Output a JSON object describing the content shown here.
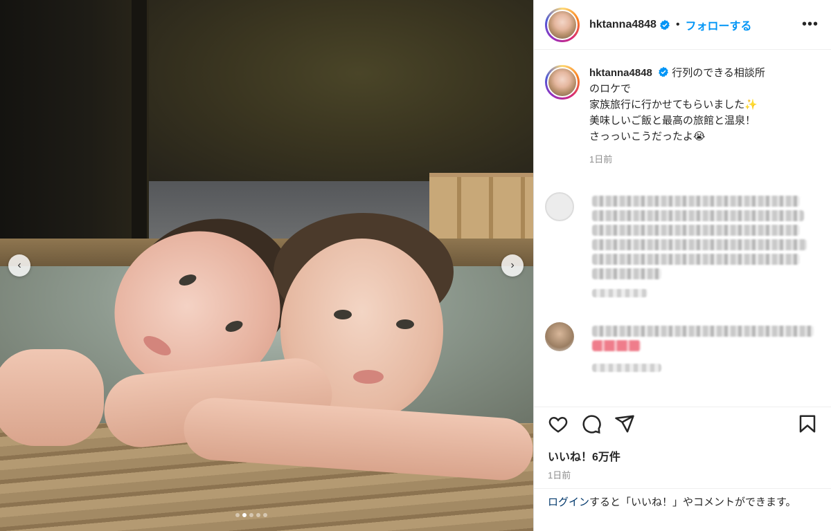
{
  "post": {
    "username": "hktanna4848",
    "follow_label": "フォローする",
    "more_label": "•••",
    "separator": "•"
  },
  "caption": {
    "username": "hktanna4848",
    "lines": [
      "行列のできる相談所",
      "のロケで",
      "家族旅行に行かせてもらいました✨",
      "美味しいご飯と最高の旅館と温泉！",
      "さっっいこうだったよ😭"
    ],
    "time": "1日前"
  },
  "actions": {
    "likes": "いいね！6万件",
    "time": "1日前"
  },
  "login_prompt": {
    "link": "ログイン",
    "rest": "すると「いいね！」やコメントができます。"
  },
  "media": {
    "prev": "‹",
    "next": "›",
    "slide_count": 5,
    "active_slide": 1
  },
  "colors": {
    "link": "#0095f6",
    "verified": "#0095f6",
    "text": "#262626",
    "muted": "#8e8e8e"
  }
}
